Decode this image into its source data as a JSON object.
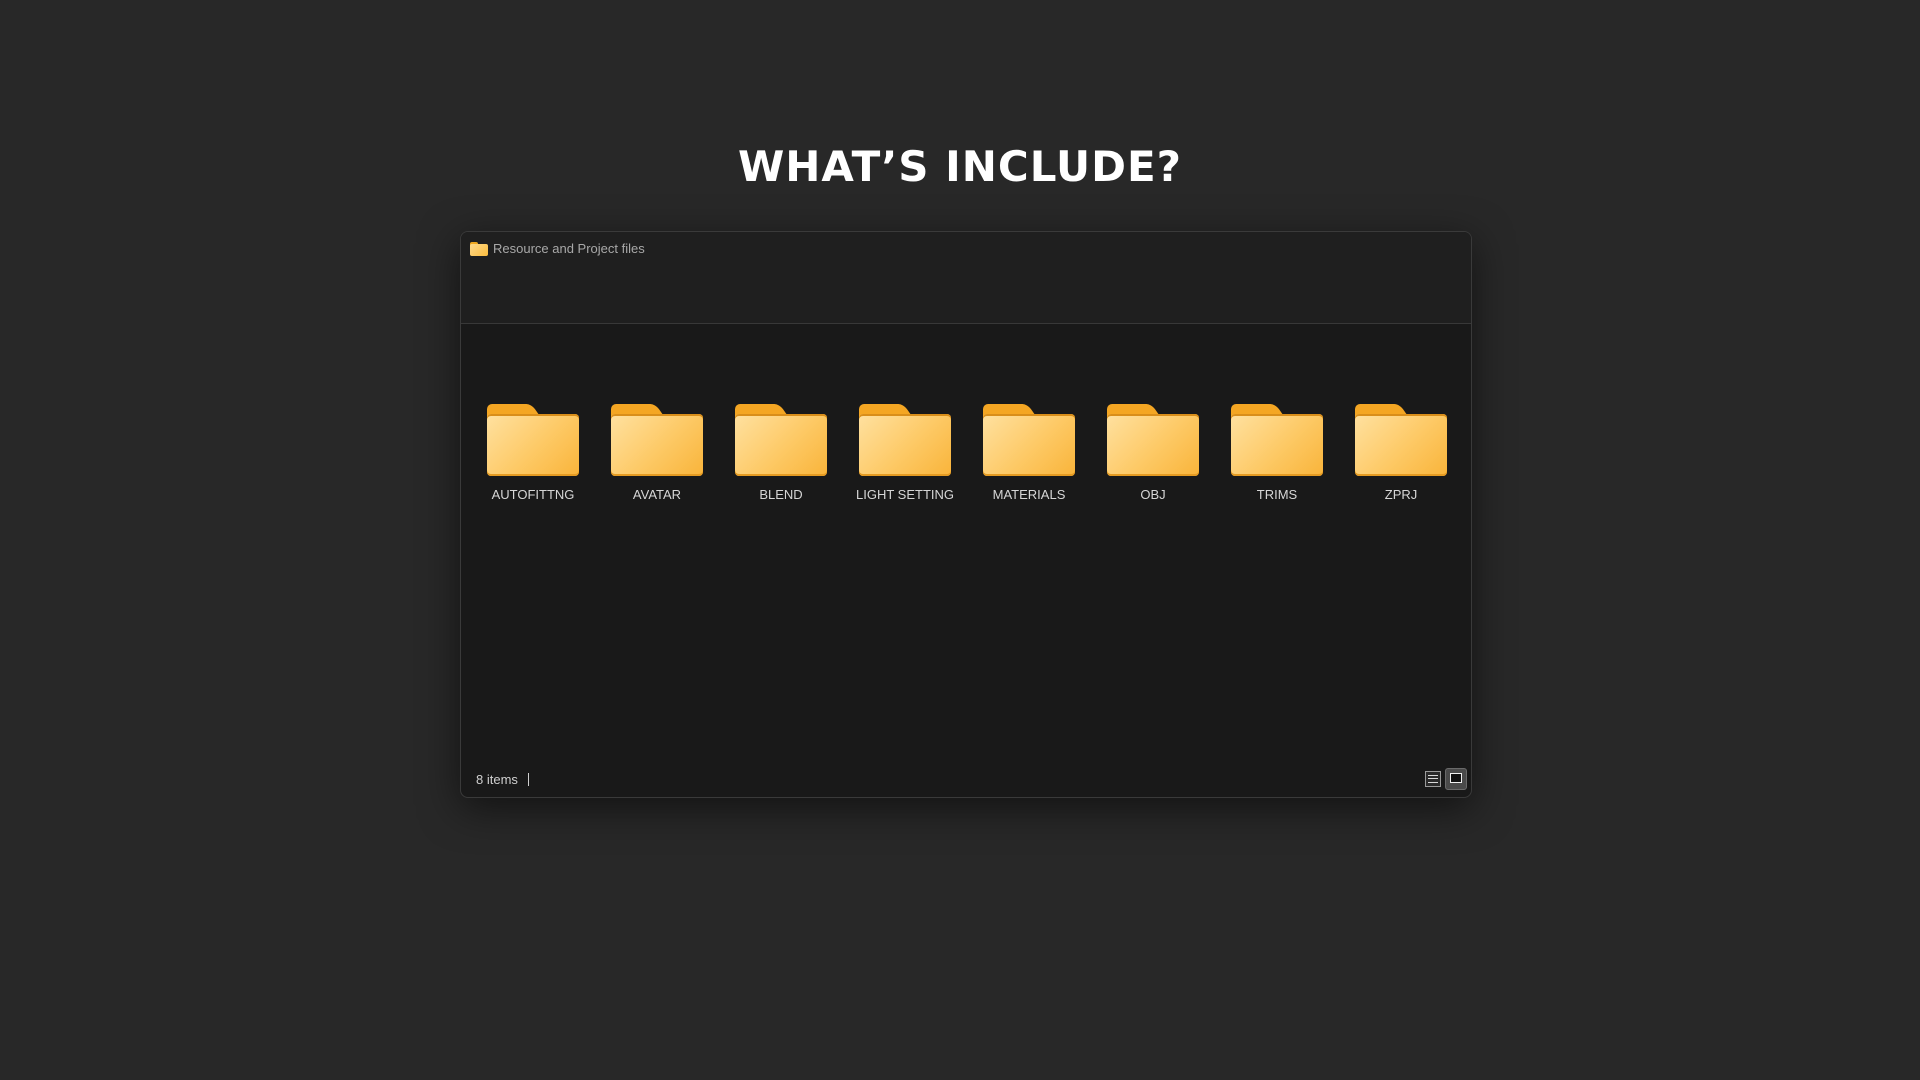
{
  "page": {
    "title": "WHAT’S INCLUDE?"
  },
  "window": {
    "breadcrumb": "Resource and Project files",
    "folders": [
      {
        "label": "AUTOFITTNG"
      },
      {
        "label": "AVATAR"
      },
      {
        "label": "BLEND"
      },
      {
        "label": "LIGHT SETTING"
      },
      {
        "label": "MATERIALS"
      },
      {
        "label": "OBJ"
      },
      {
        "label": "TRIMS"
      },
      {
        "label": "ZPRJ"
      }
    ],
    "status": {
      "item_count": "8 items"
    },
    "view_modes": {
      "details": "details-view-icon",
      "large_icons": "large-icons-view-icon",
      "active": "large_icons"
    }
  },
  "colors": {
    "background": "#282828",
    "window_body": "#191919",
    "window_header": "#1f1f1f",
    "folder_tab": "#f4a623",
    "folder_front": "#fdc965"
  }
}
